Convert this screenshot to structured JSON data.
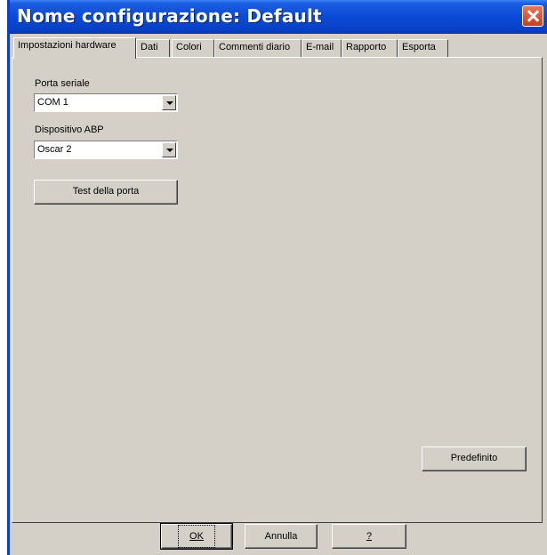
{
  "window": {
    "title": "Nome configurazione: Default"
  },
  "tabs": [
    {
      "label": "Impostazioni hardware"
    },
    {
      "label": "Dati"
    },
    {
      "label": "Colori"
    },
    {
      "label": "Commenti diario"
    },
    {
      "label": "E-mail"
    },
    {
      "label": "Rapporto"
    },
    {
      "label": "Esporta"
    }
  ],
  "hardware": {
    "serial_port_label": "Porta seriale",
    "serial_port_value": "COM 1",
    "abp_device_label": "Dispositivo ABP",
    "abp_device_value": "Oscar 2",
    "test_port_button": "Test della porta",
    "default_button": "Predefinito"
  },
  "footer": {
    "ok_button": "OK",
    "cancel_button": "Annulla",
    "help_button": "?"
  },
  "colors": {
    "titlebar": "#0a49d6",
    "dialog_bg": "#d4d0c8",
    "close_button": "#c93f1a"
  },
  "icons": {
    "close": "close-icon",
    "dropdown": "chevron-down-icon"
  }
}
